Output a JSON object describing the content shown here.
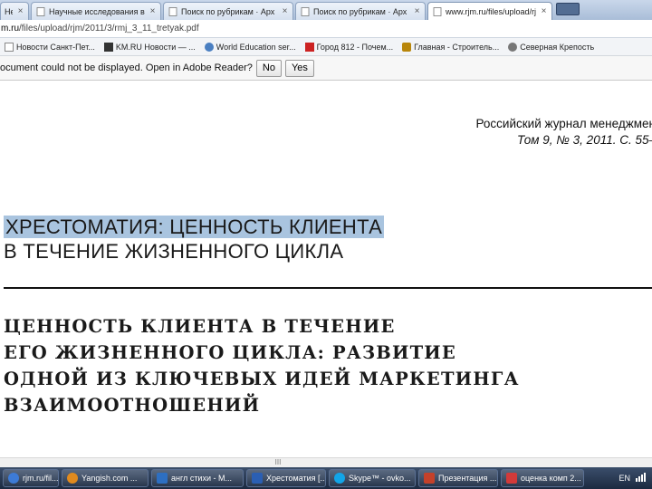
{
  "tabs": [
    {
      "label": "Не",
      "fav": "doc-icon"
    },
    {
      "label": "Научные исследования в I",
      "fav": "page-icon"
    },
    {
      "label": "Поиск по рубрикам · Арх",
      "fav": "page-icon"
    },
    {
      "label": "Поиск по рубрикам · Арх",
      "fav": "page-icon"
    },
    {
      "label": "www.rjm.ru/files/upload/rjm",
      "fav": "page-icon"
    }
  ],
  "address": {
    "host": "m.ru",
    "path": "/files/upload/rjm/2011/3/rmj_3_11_tretyak.pdf"
  },
  "bookmarks": [
    {
      "label": "Новости Санкт-Пет...",
      "color": "#c0392b"
    },
    {
      "label": "KM.RU Новости — ...",
      "color": "#333333"
    },
    {
      "label": "World Education ser...",
      "color": "#4a7fc1"
    },
    {
      "label": "Город 812 - Почем...",
      "color": "#cc2222"
    },
    {
      "label": "Главная - Строитель...",
      "color": "#b8860b"
    },
    {
      "label": "Северная Крепость",
      "color": "#666666"
    }
  ],
  "infobar": {
    "message": "ocument could not be displayed. Open in Adobe Reader?",
    "no_label": "No",
    "yes_label": "Yes"
  },
  "pdf": {
    "journal_name": "Российский журнал менеджмен",
    "journal_issue": "Том 9, № 3, 2011. С. 55–",
    "section_line1": "ХРЕСТОМАТИЯ: ЦЕННОСТЬ КЛИЕНТА",
    "section_line2": "В ТЕЧЕНИЕ ЖИЗНЕННОГО ЦИКЛА",
    "title_lines": [
      "ЦЕННОСТЬ КЛИЕНТА В ТЕЧЕНИЕ",
      "ЕГО ЖИЗНЕННОГО ЦИКЛА: РАЗВИТИЕ",
      "ОДНОЙ ИЗ КЛЮЧЕВЫХ ИДЕЙ МАРКЕТИНГА",
      "ВЗАИМООТНОШЕНИЙ"
    ],
    "highlight_color": "#a9c4df"
  },
  "scrollbar": {
    "grip": "III"
  },
  "taskbar": {
    "tasks": [
      {
        "label": "rjm.ru/fil...",
        "color": "#3d7bd6"
      },
      {
        "label": "Yangish.com ...",
        "color": "#e08a1e"
      },
      {
        "label": "англ стихи - M...",
        "color": "#2d6fc2"
      },
      {
        "label": "Хрестоматия [...",
        "color": "#2b5fb3"
      },
      {
        "label": "Skype™ - ovko...",
        "color": "#12a5e8"
      },
      {
        "label": "Презентация ...",
        "color": "#c4412a"
      },
      {
        "label": "оценка комп 2...",
        "color": "#d23a3a"
      }
    ],
    "language": "EN"
  }
}
